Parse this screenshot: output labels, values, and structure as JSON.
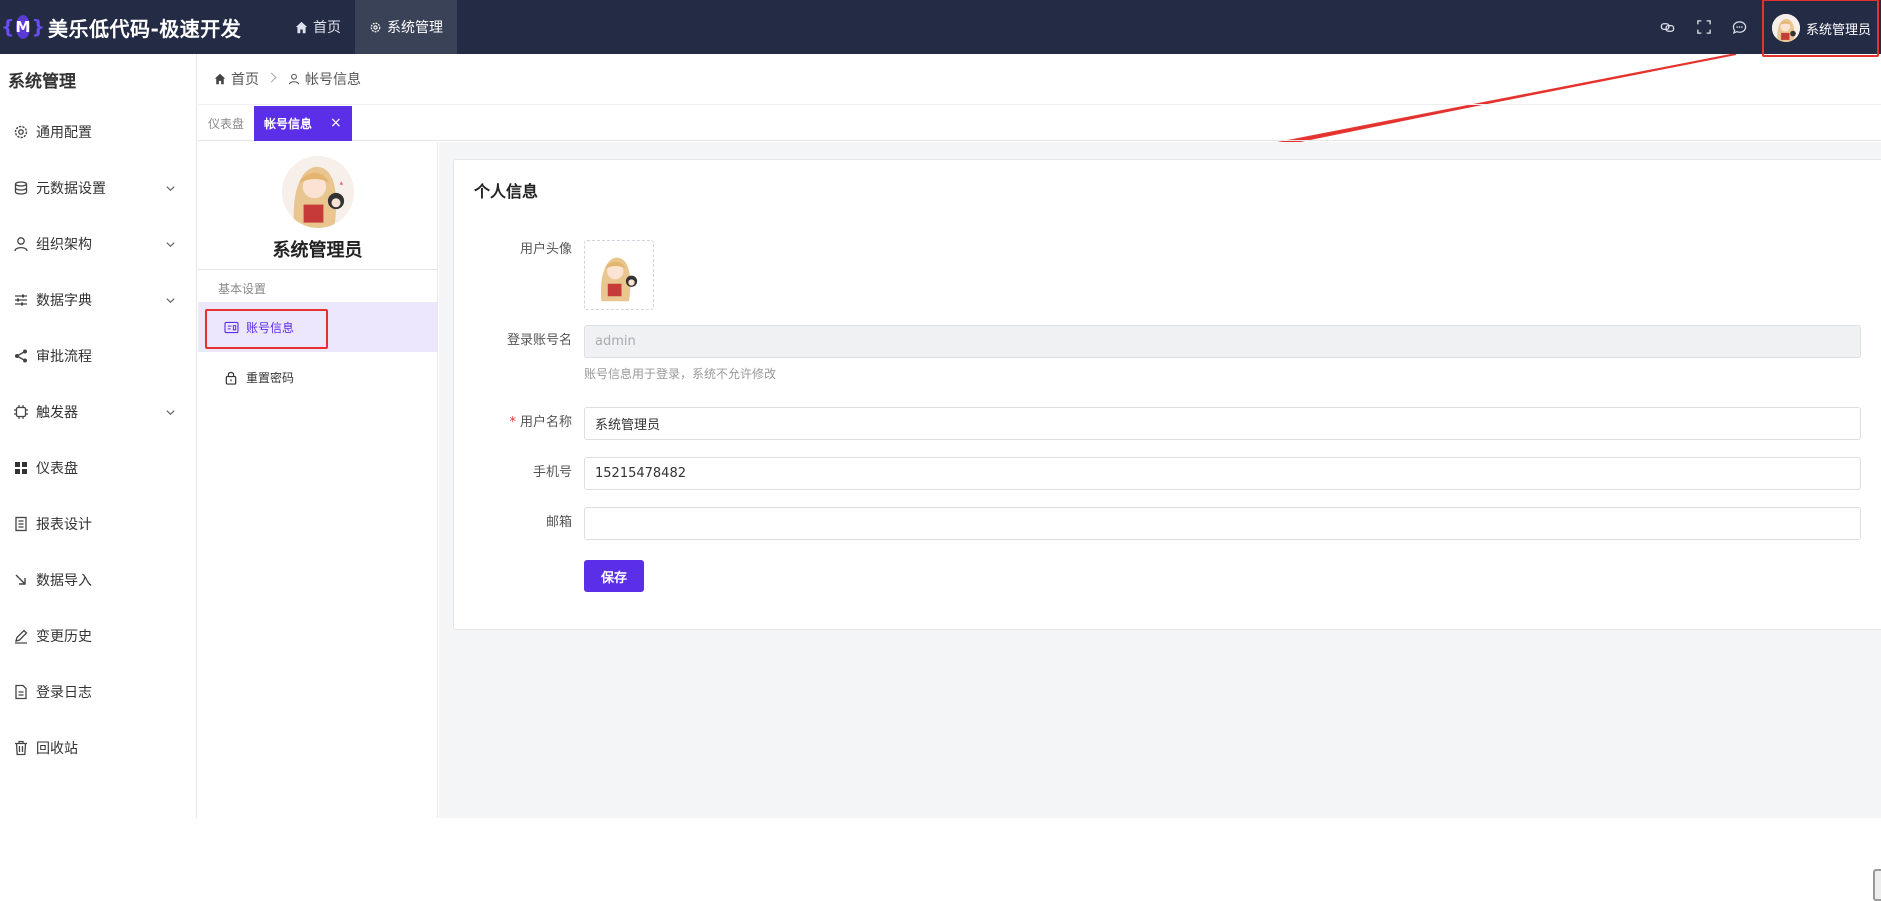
{
  "header": {
    "brand_logo": "{M}",
    "brand_title": "美乐低代码-极速开发",
    "nav": [
      {
        "label": "首页",
        "icon": "home-icon"
      },
      {
        "label": "系统管理",
        "icon": "gear-icon"
      }
    ],
    "tools": [
      "link-icon",
      "fullscreen-icon",
      "chat-icon"
    ],
    "user_name": "系统管理员"
  },
  "sidebar": {
    "title": "系统管理",
    "items": [
      {
        "label": "通用配置",
        "icon": "gear-icon",
        "expandable": false
      },
      {
        "label": "元数据设置",
        "icon": "database-icon",
        "expandable": true
      },
      {
        "label": "组织架构",
        "icon": "user-icon",
        "expandable": true
      },
      {
        "label": "数据字典",
        "icon": "sliders-icon",
        "expandable": true
      },
      {
        "label": "审批流程",
        "icon": "share-icon",
        "expandable": false
      },
      {
        "label": "触发器",
        "icon": "chip-icon",
        "expandable": true
      },
      {
        "label": "仪表盘",
        "icon": "grid-icon",
        "expandable": false
      },
      {
        "label": "报表设计",
        "icon": "report-icon",
        "expandable": false
      },
      {
        "label": "数据导入",
        "icon": "import-icon",
        "expandable": false
      },
      {
        "label": "变更历史",
        "icon": "edit-icon",
        "expandable": false
      },
      {
        "label": "登录日志",
        "icon": "log-icon",
        "expandable": false
      },
      {
        "label": "回收站",
        "icon": "trash-icon",
        "expandable": false
      }
    ]
  },
  "breadcrumb": {
    "home": "首页",
    "current": "帐号信息"
  },
  "tabs": [
    {
      "label": "仪表盘",
      "active": false
    },
    {
      "label": "帐号信息",
      "active": true,
      "close": "×"
    }
  ],
  "profile": {
    "name": "系统管理员",
    "group_label": "基本设置",
    "items": [
      {
        "label": "账号信息",
        "icon": "id-card-icon",
        "active": true
      },
      {
        "label": "重置密码",
        "icon": "lock-icon",
        "active": false
      }
    ]
  },
  "form": {
    "title": "个人信息",
    "avatar_label": "用户头像",
    "account_label": "登录账号名",
    "account_value": "admin",
    "account_hint": "账号信息用于登录，系统不允许修改",
    "username_required": "*",
    "username_label": "用户名称",
    "username_value": "系统管理员",
    "phone_label": "手机号",
    "phone_value": "15215478482",
    "email_label": "邮箱",
    "email_value": "",
    "save_label": "保存"
  },
  "colors": {
    "topbar": "#232b45",
    "accent": "#5b2ee8",
    "highlight": "#e5322d"
  }
}
